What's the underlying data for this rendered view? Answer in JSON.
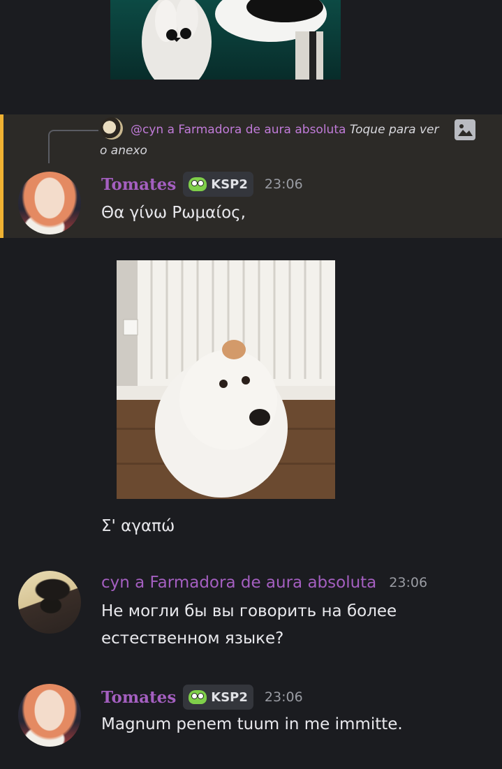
{
  "highlighted_message": {
    "reply": {
      "mention": "@cyn a Farmadora de aura absoluta",
      "hint": "Toque para ver o anexo"
    },
    "author": "Tomates",
    "badge": "KSP2",
    "time": "23:06",
    "text": "Θα γίνω Ρωμαίος,"
  },
  "followup_text": "Σ' αγαπώ",
  "messages": [
    {
      "author": "cyn a Farmadora de aura absoluta",
      "time": "23:06",
      "text_line1": "Не могли бы вы говорить на более",
      "text_line2": "естественном языке?"
    },
    {
      "author": "Tomates",
      "badge": "KSP2",
      "time": "23:06",
      "text": "Magnum penem tuum in me immitte."
    }
  ],
  "icons": {
    "reply_avatar": "cyn-avatar",
    "attachment": "image-icon",
    "badge_icon": "frog-icon"
  },
  "colors": {
    "background": "#1b1c20",
    "highlight_background": "#2c2a27",
    "highlight_bar": "#f0b232",
    "username": "#a45fc0"
  }
}
